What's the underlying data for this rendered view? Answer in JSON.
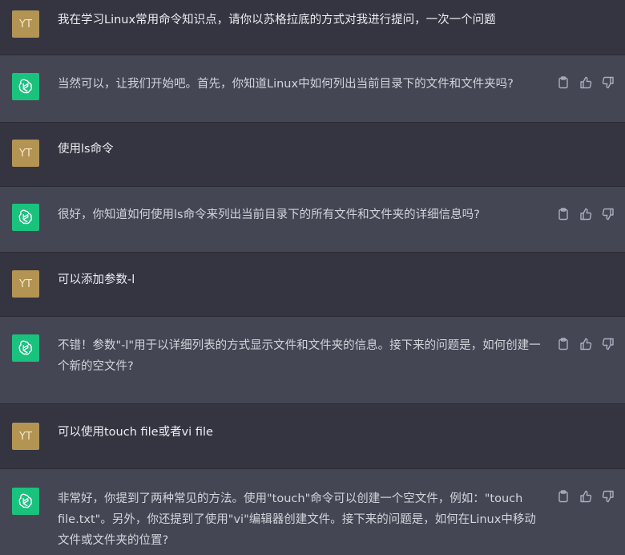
{
  "conversation": [
    {
      "role": "user",
      "avatar": "YT",
      "text": "我在学习Linux常用命令知识点，请你以苏格拉底的方式对我进行提问，一次一个问题"
    },
    {
      "role": "assistant",
      "text": "当然可以，让我们开始吧。首先，你知道Linux中如何列出当前目录下的文件和文件夹吗?"
    },
    {
      "role": "user",
      "avatar": "YT",
      "text": "使用ls命令"
    },
    {
      "role": "assistant",
      "text": "很好，你知道如何使用ls命令来列出当前目录下的所有文件和文件夹的详细信息吗?"
    },
    {
      "role": "user",
      "avatar": "YT",
      "text": "可以添加参数-l"
    },
    {
      "role": "assistant",
      "text": "不错！参数\"-l\"用于以详细列表的方式显示文件和文件夹的信息。接下来的问题是，如何创建一个新的空文件?"
    },
    {
      "role": "user",
      "avatar": "YT",
      "text": "可以使用touch file或者vi file"
    },
    {
      "role": "assistant",
      "text": "非常好，你提到了两种常见的方法。使用\"touch\"命令可以创建一个空文件，例如：\"touch file.txt\"。另外，你还提到了使用\"vi\"编辑器创建文件。接下来的问题是，如何在Linux中移动文件或文件夹的位置?"
    }
  ],
  "icons": {
    "assistant_avatar": "openai-logo-icon",
    "copy": "clipboard-icon",
    "like": "thumbs-up-icon",
    "dislike": "thumbs-down-icon"
  },
  "colors": {
    "user_bg": "#343541",
    "assistant_bg": "#444654",
    "user_avatar": "#b39453",
    "assistant_avatar": "#19c37d"
  }
}
